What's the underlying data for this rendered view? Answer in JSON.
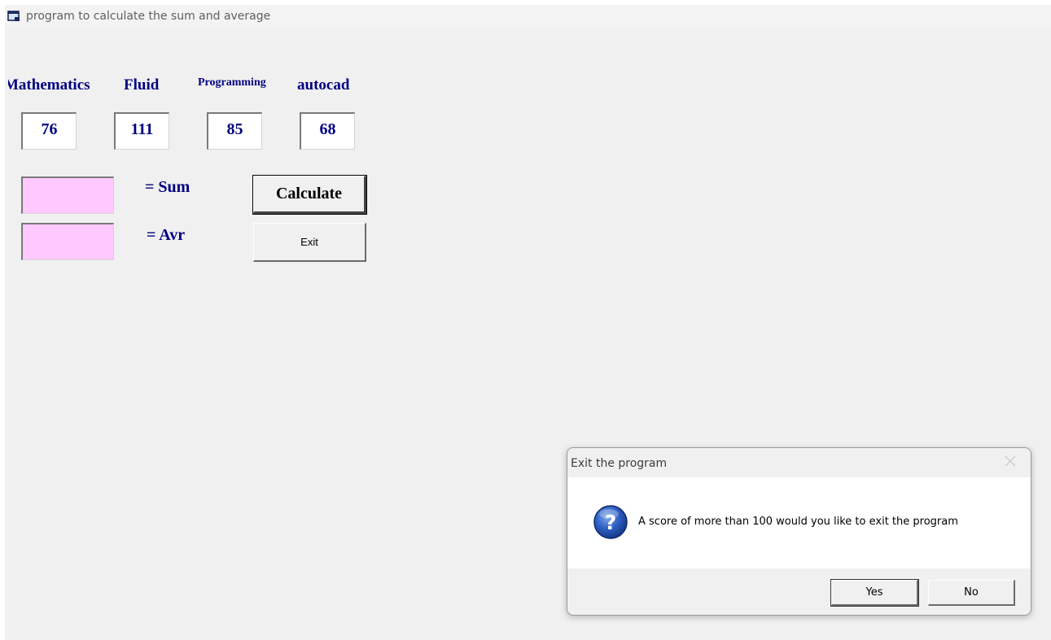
{
  "window": {
    "title": "program to calculate the sum and average"
  },
  "subjects": [
    {
      "label": "Mathematics",
      "score": "76"
    },
    {
      "label": "Fluid",
      "score": "111"
    },
    {
      "label": "Programming",
      "score": "85"
    },
    {
      "label": "autocad",
      "score": "68"
    }
  ],
  "results": {
    "sum_value": "",
    "sum_label": "= Sum",
    "avg_value": "",
    "avg_label": "= Avr",
    "result_bg_color": "#ffc8ff"
  },
  "buttons": {
    "calculate": "Calculate",
    "exit": "Exit"
  },
  "dialog": {
    "title": "Exit the program",
    "message": "A score of more than 100 would you like to exit the program",
    "icon": "question-icon",
    "yes": "Yes",
    "no": "No"
  },
  "colors": {
    "label_color": "#000080",
    "window_bg": "#f0f0f0"
  }
}
